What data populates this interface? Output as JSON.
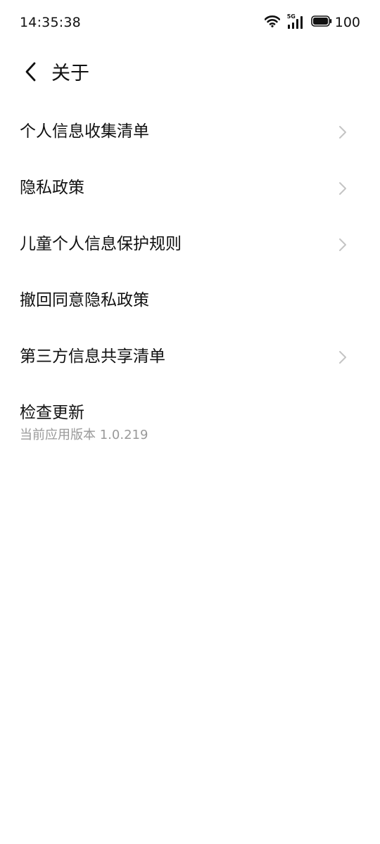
{
  "status_bar": {
    "time": "14:35:38",
    "network_label": "5G",
    "battery": "100",
    "icons": [
      "wifi-icon",
      "cellular-5g-icon",
      "battery-icon"
    ]
  },
  "header": {
    "back_icon": "chevron-left-icon",
    "title": "关于"
  },
  "menu": {
    "items": [
      {
        "label": "个人信息收集清单",
        "has_chevron": true
      },
      {
        "label": "隐私政策",
        "has_chevron": true
      },
      {
        "label": "儿童个人信息保护规则",
        "has_chevron": true
      },
      {
        "label": "撤回同意隐私政策",
        "has_chevron": false
      },
      {
        "label": "第三方信息共享清单",
        "has_chevron": true
      },
      {
        "label": "检查更新",
        "subtitle": "当前应用版本 1.0.219",
        "has_chevron": false
      }
    ]
  },
  "colors": {
    "background": "#ffffff",
    "text_primary": "#111111",
    "text_secondary": "#9a9a9a",
    "chevron": "#c4c4c4"
  }
}
